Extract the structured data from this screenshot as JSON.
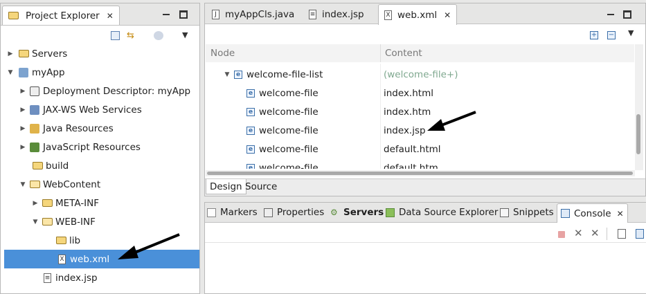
{
  "project_explorer": {
    "title": "Project Explorer",
    "tree": [
      {
        "label": "Servers"
      },
      {
        "label": "myApp"
      },
      {
        "label": "Deployment Descriptor: myApp"
      },
      {
        "label": "JAX-WS Web Services"
      },
      {
        "label": "Java Resources"
      },
      {
        "label": "JavaScript Resources"
      },
      {
        "label": "build"
      },
      {
        "label": "WebContent"
      },
      {
        "label": "META-INF"
      },
      {
        "label": "WEB-INF"
      },
      {
        "label": "lib"
      },
      {
        "label": "web.xml"
      },
      {
        "label": "index.jsp"
      }
    ]
  },
  "editor": {
    "tabs": [
      {
        "label": "myAppCls.java"
      },
      {
        "label": "index.jsp"
      },
      {
        "label": "web.xml"
      }
    ],
    "columns": {
      "node": "Node",
      "content": "Content"
    },
    "rows": [
      {
        "node": "welcome-file-list",
        "content": "(welcome-file+)"
      },
      {
        "node": "welcome-file",
        "content": "index.html"
      },
      {
        "node": "welcome-file",
        "content": "index.htm"
      },
      {
        "node": "welcome-file",
        "content": "index.jsp"
      },
      {
        "node": "welcome-file",
        "content": "default.html"
      },
      {
        "node": "welcome-file",
        "content": "default.htm"
      }
    ],
    "bottom_tabs": {
      "design": "Design",
      "source": "Source"
    }
  },
  "bottom_panel": {
    "tabs": [
      {
        "label": "Markers"
      },
      {
        "label": "Properties"
      },
      {
        "label": "Servers"
      },
      {
        "label": "Data Source Explorer"
      },
      {
        "label": "Snippets"
      },
      {
        "label": "Console"
      }
    ]
  },
  "icons": {
    "element": "e",
    "xml_file": "X"
  }
}
